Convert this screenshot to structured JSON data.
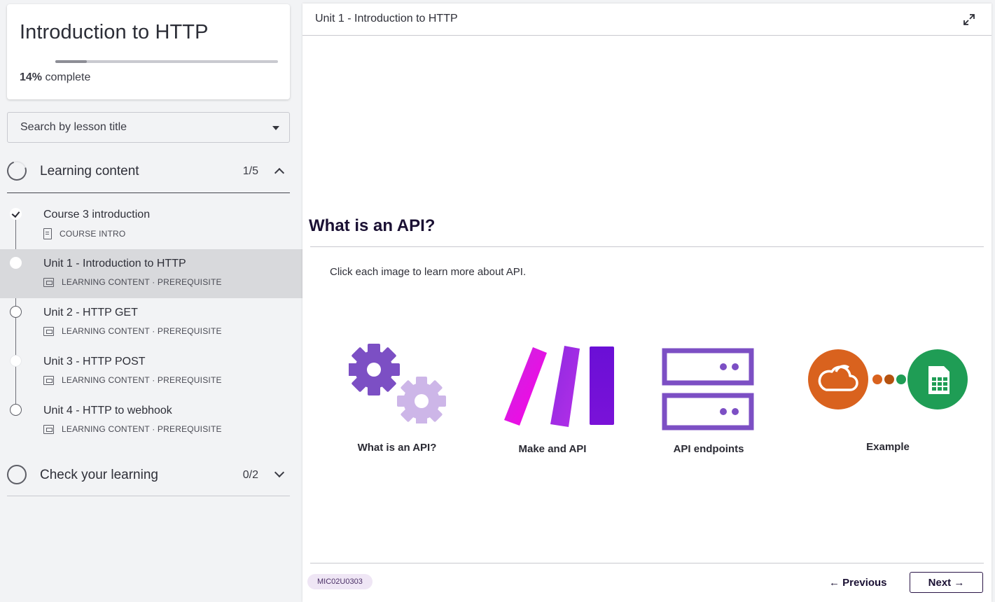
{
  "course": {
    "title": "Introduction to HTTP",
    "progress_percent": 14,
    "progress_pct_label": "14%",
    "progress_suffix": " complete"
  },
  "search": {
    "placeholder": "Search by lesson title"
  },
  "sections": [
    {
      "label": "Learning content",
      "count": "1/5",
      "expanded": true
    },
    {
      "label": "Check your learning",
      "count": "0/2",
      "expanded": false
    }
  ],
  "lessons": [
    {
      "title": "Course 3 introduction",
      "meta": "COURSE INTRO",
      "status": "complete"
    },
    {
      "title": "Unit 1 - Introduction to HTTP",
      "meta": "LEARNING CONTENT · PREREQUISITE",
      "status": "current"
    },
    {
      "title": "Unit 2 - HTTP GET",
      "meta": "LEARNING CONTENT · PREREQUISITE",
      "status": "incomplete"
    },
    {
      "title": "Unit 3 - HTTP POST",
      "meta": "LEARNING CONTENT · PREREQUISITE",
      "status": "incomplete"
    },
    {
      "title": "Unit 4 - HTTP to webhook",
      "meta": "LEARNING CONTENT · PREREQUISITE",
      "status": "incomplete"
    }
  ],
  "main": {
    "unit_title": "Unit 1 - Introduction to HTTP",
    "content_title": "What is an API?",
    "instruction": "Click each image to learn more about API.",
    "cards": [
      {
        "label": "What is an API?",
        "icon": "gears-icon"
      },
      {
        "label": "Make and API",
        "icon": "make-logo-icon"
      },
      {
        "label": "API endpoints",
        "icon": "server-icon"
      },
      {
        "label": "Example",
        "icon": "cloud-to-sheets-icon"
      }
    ],
    "code_badge": "MIC02U0303",
    "prev_label": "← Previous",
    "next_label": "Next →"
  },
  "colors": {
    "accent_dark": "#1a1033",
    "purple": "#7c4fc4",
    "purple_light": "#cdb6e8",
    "magenta": "#e700e8",
    "orange": "#d9621e",
    "green": "#1f9d55"
  }
}
